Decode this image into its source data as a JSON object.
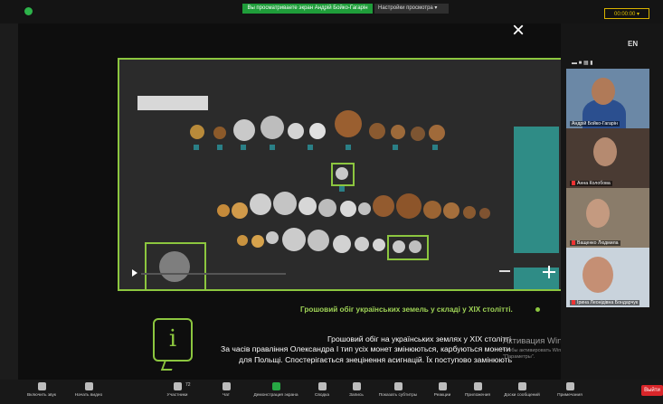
{
  "topbar": {
    "share_banner": "Вы просматриваете экран Андрій Бойко-Гагарін",
    "view_options": "Настройки просмотра ▾",
    "timer": "00:00:00 ▾"
  },
  "main": {
    "close_symbol": "×",
    "caption_heading": "Грошовий обіг українських земель у складі у XIX столітті.",
    "info_symbol": "i",
    "subtitles": [
      "Грошовий обіг на українських землях у XIX столітті",
      "За часів правління Олександра I тип усіх монет змінюються, карбуються монети",
      "для Польщі. Спостерігається знецінення асигнацій. Їх поступово замінюють"
    ],
    "windows_activation": {
      "title": "Активация Windows",
      "subtitle": "Чтобы активировать Windows, перейдите в раздел \"Параметры\"."
    }
  },
  "right_panel": {
    "view_toggles": "▬  ■  ▦  ▮",
    "language": "EN",
    "participants": [
      {
        "name": "Андрій Бойко-Гагарін",
        "muted": false
      },
      {
        "name": "Анна Колобова",
        "muted": true
      },
      {
        "name": "Ващенко Людмила",
        "muted": true
      },
      {
        "name": "Ірина Леонідівна Бондарчук",
        "muted": true
      }
    ]
  },
  "toolbar": {
    "items": [
      {
        "label": "Включить звук",
        "icon": "microphone-off-icon"
      },
      {
        "label": "Начать видео",
        "icon": "video-off-icon"
      },
      {
        "label": "Участники",
        "icon": "participants-icon",
        "count": "72"
      },
      {
        "label": "Чат",
        "icon": "chat-icon"
      },
      {
        "label": "Демонстрация экрана",
        "icon": "share-screen-icon"
      },
      {
        "label": "Сводка",
        "icon": "summary-icon"
      },
      {
        "label": "Запись",
        "icon": "record-icon"
      },
      {
        "label": "Показать субтитры",
        "icon": "captions-icon"
      },
      {
        "label": "Реакции",
        "icon": "reactions-icon"
      },
      {
        "label": "Приложения",
        "icon": "apps-icon"
      },
      {
        "label": "Доски сообщений",
        "icon": "whiteboard-icon"
      },
      {
        "label": "Примечания",
        "icon": "notes-icon"
      }
    ],
    "leave": "Выйти"
  },
  "colors": {
    "accent_green": "#8cc63f",
    "share_green": "#1f9d3a",
    "leave_red": "#d9262a"
  }
}
